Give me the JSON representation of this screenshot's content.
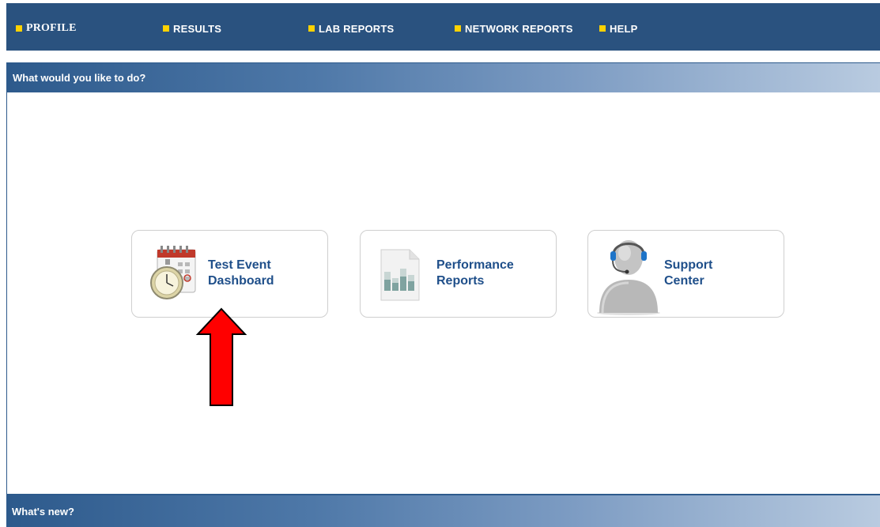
{
  "nav": {
    "items": [
      {
        "label": "PROFILE"
      },
      {
        "label": "RESULTS"
      },
      {
        "label": "LAB REPORTS"
      },
      {
        "label": "NETWORK REPORTS"
      },
      {
        "label": "HELP"
      }
    ]
  },
  "main_panel": {
    "title": "What would you like to do?",
    "tiles": [
      {
        "line1": "Test Event",
        "line2": "Dashboard",
        "icon": "calendar-stopwatch-icon"
      },
      {
        "line1": "Performance",
        "line2": "Reports",
        "icon": "bar-chart-document-icon"
      },
      {
        "line1": "Support",
        "line2": "Center",
        "icon": "headset-person-icon"
      }
    ]
  },
  "news_panel": {
    "title": "What's new?"
  },
  "colors": {
    "nav_bg": "#2a527f",
    "nav_square": "#ffd200",
    "tile_text": "#1f4f8a",
    "arrow": "#ff0000"
  }
}
